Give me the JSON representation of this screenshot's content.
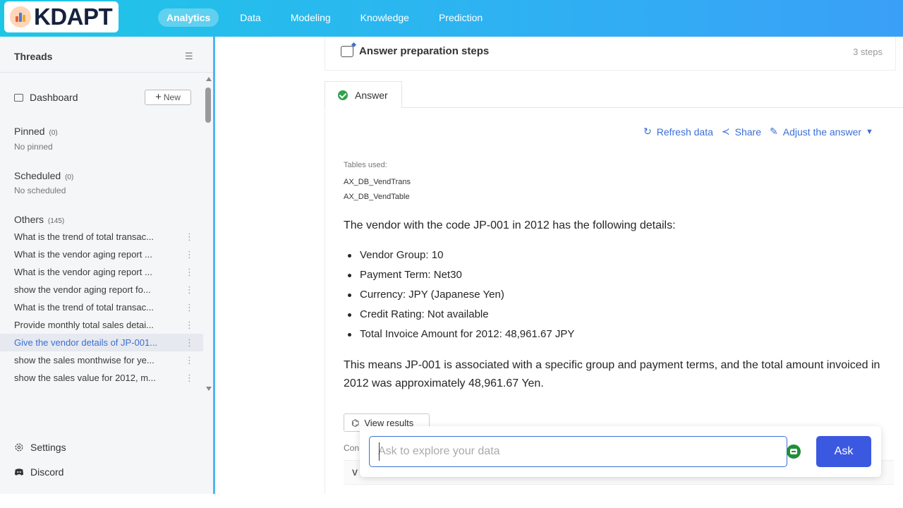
{
  "app": {
    "logo_text": "KDAPT",
    "nav": [
      "Analytics",
      "Data",
      "Modeling",
      "Knowledge",
      "Prediction"
    ],
    "active_nav": "Analytics"
  },
  "sidebar": {
    "title": "Threads",
    "dashboard_label": "Dashboard",
    "new_label": "New",
    "pinned": {
      "title": "Pinned",
      "count": "(0)",
      "empty": "No pinned"
    },
    "scheduled": {
      "title": "Scheduled",
      "count": "(0)",
      "empty": "No scheduled"
    },
    "others": {
      "title": "Others",
      "count": "(145)"
    },
    "threads": [
      "What is the trend of total transac...",
      "What is the vendor aging report ...",
      "What is the vendor aging report ...",
      "show the vendor aging report fo...",
      "What is the trend of total transac...",
      "Provide monthly total sales detai...",
      "Give the vendor details of JP-001...",
      "show the sales monthwise for ye...",
      "show the sales value for 2012, m..."
    ],
    "selected_index": 6,
    "settings_label": "Settings",
    "discord_label": "Discord"
  },
  "main": {
    "prep_title": "Answer preparation steps",
    "prep_steps": "3 steps",
    "tab_label": "Answer",
    "actions": {
      "refresh": "Refresh data",
      "share": "Share",
      "adjust": "Adjust the answer"
    },
    "tables_label": "Tables used:",
    "tables": [
      "AX_DB_VendTrans",
      "AX_DB_VendTable"
    ],
    "intro": "The vendor with the code JP-001 in 2012 has the following details:",
    "bullets": [
      "Vendor Group: 10",
      "Payment Term: Net30",
      "Currency: JPY (Japanese Yen)",
      "Credit Rating: Not available",
      "Total Invoice Amount for 2012: 48,961.67 JPY"
    ],
    "summary": "This means JP-001 is associated with a specific group and payment terms, and the total amount invoiced in 2012 was approximately 48,961.67 Yen.",
    "view_results": "View results",
    "under_text": "Con",
    "under_row_text": "V"
  },
  "ask": {
    "placeholder": "Ask to explore your data",
    "button": "Ask"
  },
  "colors": {
    "accent": "#3b6fd6",
    "ask_button": "#3b58e0",
    "topbar_start": "#1ec6e6",
    "topbar_end": "#3aa0f7"
  }
}
